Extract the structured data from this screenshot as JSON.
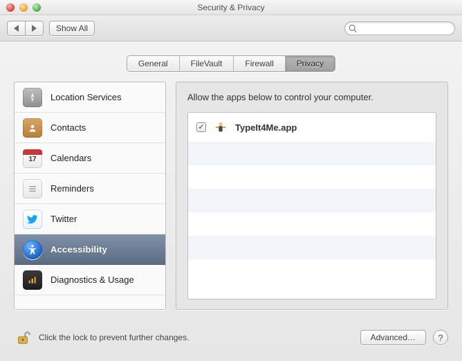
{
  "window": {
    "title": "Security & Privacy"
  },
  "toolbar": {
    "show_all_label": "Show All",
    "search_placeholder": ""
  },
  "tabs": [
    {
      "label": "General"
    },
    {
      "label": "FileVault"
    },
    {
      "label": "Firewall"
    },
    {
      "label": "Privacy"
    }
  ],
  "sidebar": {
    "items": [
      {
        "label": "Location Services"
      },
      {
        "label": "Contacts"
      },
      {
        "label": "Calendars",
        "badge": "17"
      },
      {
        "label": "Reminders"
      },
      {
        "label": "Twitter"
      },
      {
        "label": "Accessibility"
      },
      {
        "label": "Diagnostics & Usage"
      }
    ]
  },
  "right": {
    "instruction": "Allow the apps below to control your computer.",
    "apps": [
      {
        "name": "TypeIt4Me.app",
        "checked": true
      }
    ]
  },
  "footer": {
    "lock_text": "Click the lock to prevent further changes.",
    "advanced_label": "Advanced…",
    "help_label": "?"
  }
}
